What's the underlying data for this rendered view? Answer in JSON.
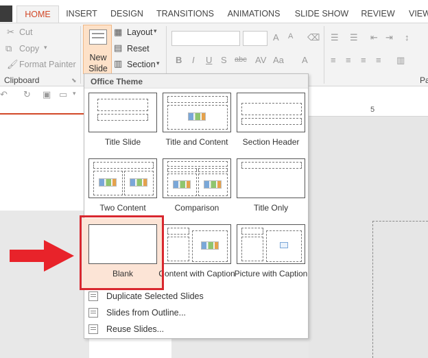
{
  "tabs": [
    {
      "label": "HOME",
      "active": true
    },
    {
      "label": "INSERT"
    },
    {
      "label": "DESIGN"
    },
    {
      "label": "TRANSITIONS"
    },
    {
      "label": "ANIMATIONS"
    },
    {
      "label": "SLIDE SHOW"
    },
    {
      "label": "REVIEW"
    },
    {
      "label": "VIEW"
    }
  ],
  "clipboard": {
    "cut": "Cut",
    "copy": "Copy",
    "format_painter": "Format Painter",
    "group_label": "Clipboard"
  },
  "slides": {
    "new_slide_line1": "New",
    "new_slide_line2": "Slide",
    "layout": "Layout",
    "reset": "Reset",
    "section": "Section"
  },
  "paragraph_label_partial": "Pa",
  "ruler_number": "5",
  "dropdown": {
    "header": "Office Theme",
    "layouts": [
      {
        "name": "Title Slide"
      },
      {
        "name": "Title and Content"
      },
      {
        "name": "Section Header"
      },
      {
        "name": "Two Content"
      },
      {
        "name": "Comparison"
      },
      {
        "name": "Title Only"
      },
      {
        "name": "Blank",
        "selected": true
      },
      {
        "name": "Content with Caption"
      },
      {
        "name": "Picture with Caption"
      }
    ],
    "commands": [
      {
        "label": "Duplicate Selected Slides"
      },
      {
        "label": "Slides from Outline..."
      },
      {
        "label": "Reuse Slides..."
      }
    ]
  },
  "colors": {
    "accent": "#d24726",
    "highlight": "#d9272e",
    "selected_bg": "#fce4d6"
  }
}
